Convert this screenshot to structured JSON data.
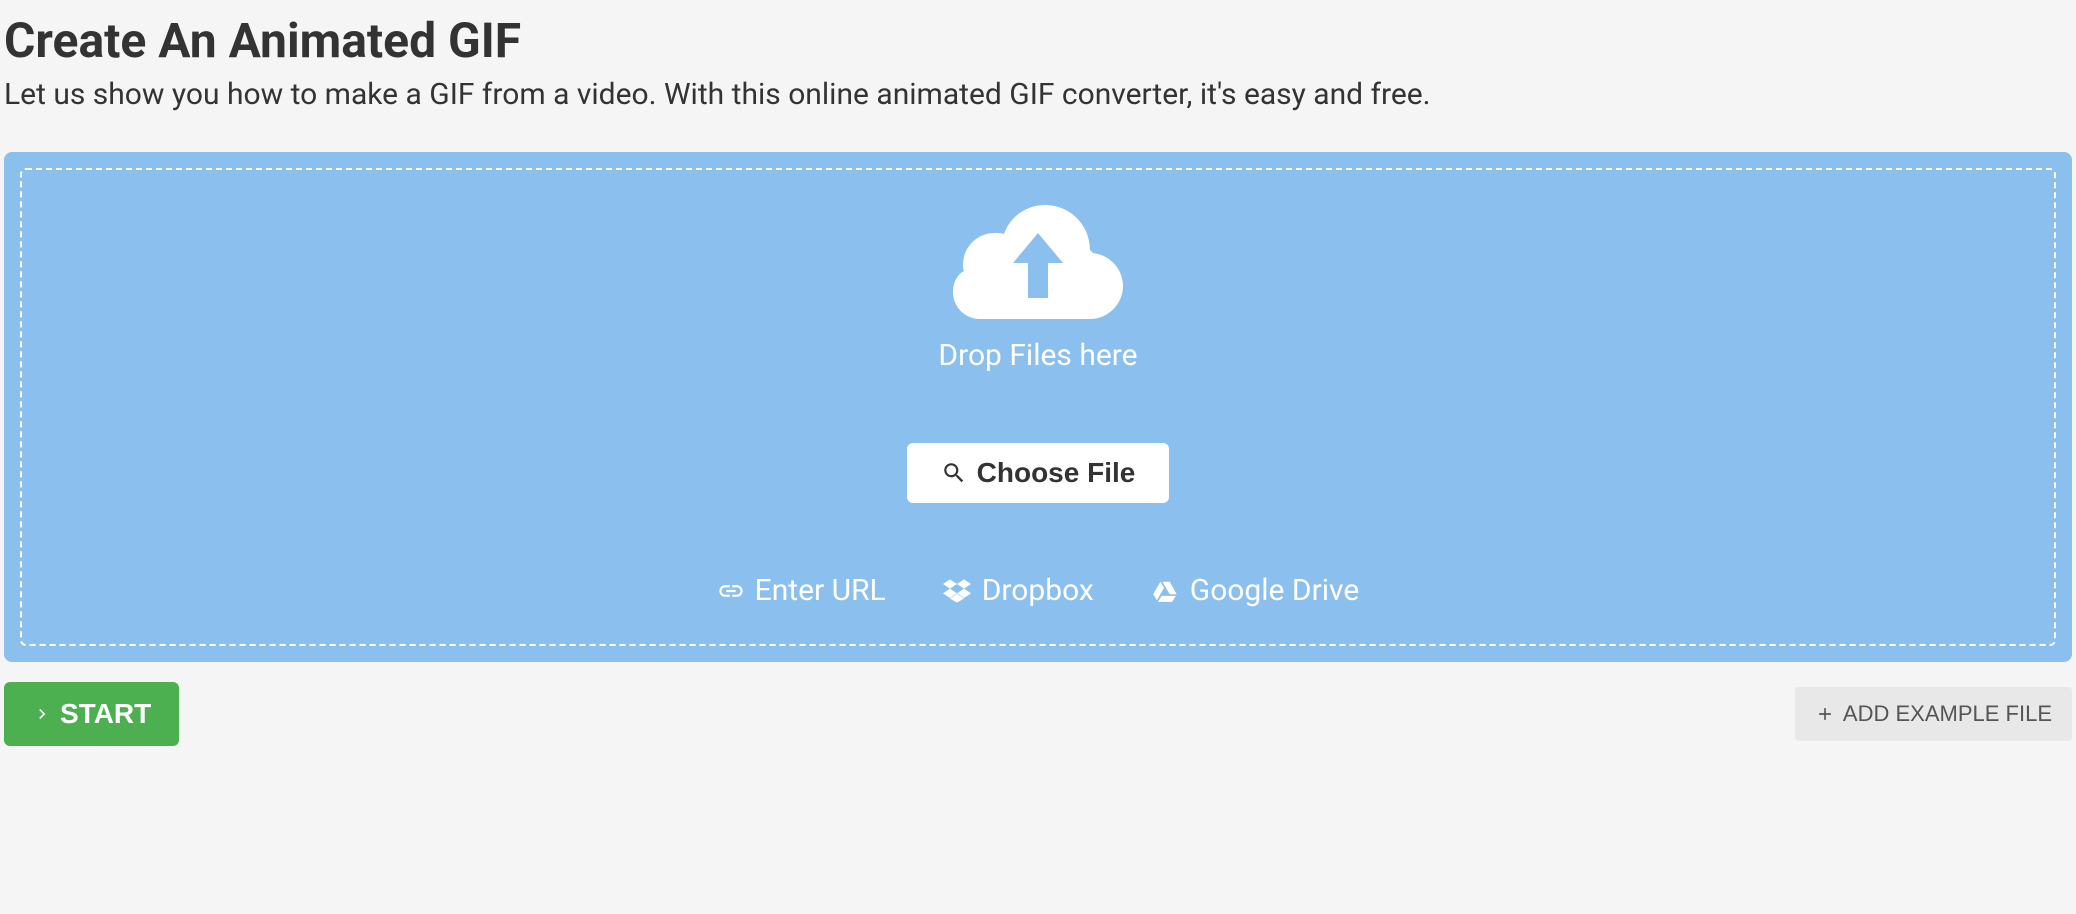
{
  "header": {
    "title": "Create An Animated GIF",
    "subtitle": "Let us show you how to make a GIF from a video. With this online animated GIF converter, it's easy and free."
  },
  "dropzone": {
    "drop_label": "Drop Files here",
    "choose_file_label": "Choose File",
    "sources": {
      "url_label": "Enter URL",
      "dropbox_label": "Dropbox",
      "gdrive_label": "Google Drive"
    }
  },
  "actions": {
    "start_label": "START",
    "add_example_label": "ADD EXAMPLE FILE"
  }
}
